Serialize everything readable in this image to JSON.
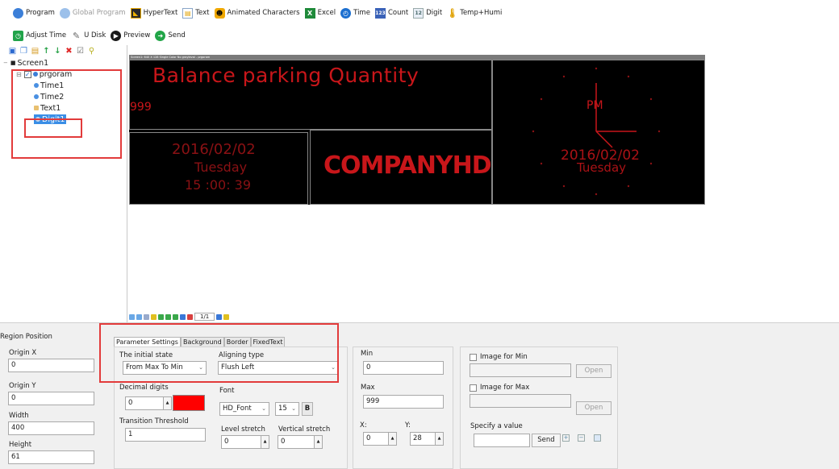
{
  "toolbar": {
    "program": "Program",
    "global_program": "Global Program",
    "hypertext": "HyperText",
    "text": "Text",
    "animated_characters": "Animated Characters",
    "excel": "Excel",
    "time": "Time",
    "count": "Count",
    "digit": "Digit",
    "temp_humi": "Temp+Humi"
  },
  "toolbar2": {
    "adjust_time": "Adjust Time",
    "u_disk": "U Disk",
    "preview": "Preview",
    "send": "Send"
  },
  "tree": {
    "screen": "Screen1",
    "program": "prgoram",
    "items": [
      "Time1",
      "Time2",
      "Text1",
      "Digit1"
    ]
  },
  "canvas": {
    "header": "Screen1: 640 X 128  Single Color No grayleval - prgoram",
    "title_text": "Balance parking Quantity",
    "digit_value": "999",
    "date": "2016/02/02",
    "weekday": "Tuesday",
    "time": "15 :00: 39",
    "company": "COMPANYHD",
    "clock_ampm": "PM",
    "clock_date": "2016/02/02",
    "clock_weekday": "Tuesday",
    "page": "1/1"
  },
  "region": {
    "title": "Region Position",
    "origin_x_label": "Origin X",
    "origin_x": "0",
    "origin_y_label": "Origin Y",
    "origin_y": "0",
    "width_label": "Width",
    "width": "400",
    "height_label": "Height",
    "height": "61"
  },
  "tabs": [
    "Parameter Settings",
    "Background",
    "Border",
    "FixedText"
  ],
  "params": {
    "initial_state_label": "The initial state",
    "initial_state": "From Max To Min",
    "aligning_label": "Aligning type",
    "aligning": "Flush Left",
    "decimal_label": "Decimal digits",
    "decimal": "0",
    "color": "#ff0000",
    "font_label": "Font",
    "font": "HD_Font",
    "font_size": "15",
    "bold": "B",
    "threshold_label": "Transition Threshold",
    "threshold": "1",
    "level_label": "Level stretch",
    "level": "0",
    "vertical_label": "Vertical stretch",
    "vertical": "0"
  },
  "minmax": {
    "min_label": "Min",
    "min": "0",
    "max_label": "Max",
    "max": "999",
    "x_label": "X:",
    "x": "0",
    "y_label": "Y:",
    "y": "28"
  },
  "images": {
    "min_label": "Image for Min",
    "max_label": "Image for Max",
    "open": "Open",
    "specify_label": "Specify a value",
    "send": "Send"
  }
}
